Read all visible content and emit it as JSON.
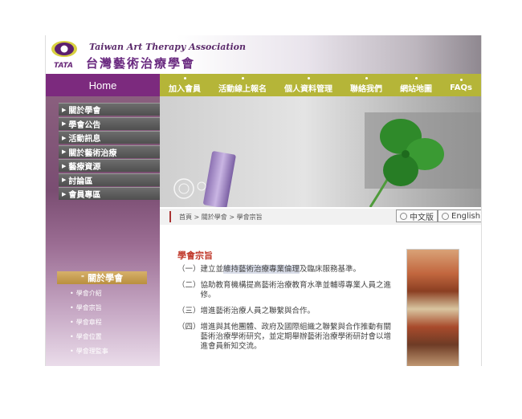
{
  "header": {
    "logo_en": "Taiwan Art Therapy Association",
    "logo_zh": "台灣藝術治療學會",
    "logo_abbr": "TATA"
  },
  "nav": {
    "home": "Home",
    "items": [
      "加入會員",
      "活動線上報名",
      "個人資料管理",
      "聯絡我們",
      "網站地圖",
      "FAQs"
    ]
  },
  "sidebar": {
    "menu": [
      "關於學會",
      "學會公告",
      "活動訊息",
      "關於藝術治療",
      "藝療資源",
      "討論區",
      "會員專區"
    ],
    "section_title": "關於學會",
    "submenu": [
      "學會介紹",
      "學會宗旨",
      "學會章程",
      "學會位置",
      "學會理監事"
    ]
  },
  "breadcrumb": {
    "text": "首頁 > 關於學會 > 學會宗旨"
  },
  "language": {
    "chinese": "中文版",
    "english": "English"
  },
  "content": {
    "title": "學會宗旨",
    "items": [
      {
        "num": "（一）",
        "pre": "建立並",
        "highlight": "維持藝術治療專業倫理",
        "post": "及臨床服務基準。"
      },
      {
        "num": "（二）",
        "pre": "協助教育機構提高藝術治療教育水準並輔導專業人員之進修。",
        "highlight": "",
        "post": ""
      },
      {
        "num": "（三）",
        "pre": "增進藝術治療人員之聯繫與合作。",
        "highlight": "",
        "post": ""
      },
      {
        "num": "（四）",
        "pre": "增進與其他團體、政府及國際組織之聯繫與合作推動有關藝術治療學術研究，並定期舉辦藝術治療學術研討會以增進會員新知交流。",
        "highlight": "",
        "post": ""
      }
    ]
  },
  "colors": {
    "nav_purple": "#7c2a7e",
    "nav_olive": "#b5b538",
    "title_red": "#c0392b"
  }
}
